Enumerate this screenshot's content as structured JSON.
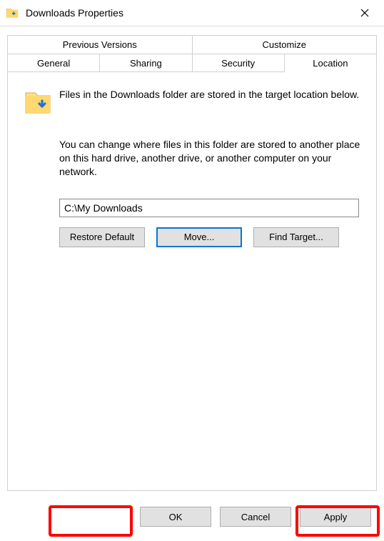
{
  "window": {
    "title": "Downloads Properties"
  },
  "tabs": {
    "row1": [
      "Previous Versions",
      "Customize"
    ],
    "row2": [
      "General",
      "Sharing",
      "Security",
      "Location"
    ],
    "active": "Location"
  },
  "location": {
    "description": "Files in the Downloads folder are stored in the target location below.",
    "info": "You can change where files in this folder are stored to another place on this hard drive, another drive, or another computer on your network.",
    "path": "C:\\My Downloads",
    "buttons": {
      "restore": "Restore Default",
      "move": "Move...",
      "find": "Find Target..."
    }
  },
  "footer": {
    "ok": "OK",
    "cancel": "Cancel",
    "apply": "Apply"
  }
}
